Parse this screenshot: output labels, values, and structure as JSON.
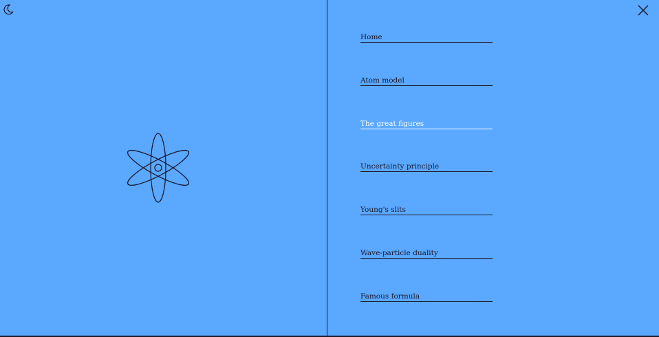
{
  "theme_toggle": {
    "icon": "moon-icon"
  },
  "close": {
    "icon": "close-icon"
  },
  "logo": {
    "icon": "atom-icon"
  },
  "menu": {
    "items": [
      {
        "label": "Home",
        "active": false
      },
      {
        "label": "Atom model",
        "active": false
      },
      {
        "label": "The great figures",
        "active": true
      },
      {
        "label": "Uncertainty principle",
        "active": false
      },
      {
        "label": "Young's slits",
        "active": false
      },
      {
        "label": "Wave-particle duality",
        "active": false
      },
      {
        "label": "Famous formula",
        "active": false
      }
    ]
  },
  "colors": {
    "background": "#5aa8ff",
    "ink": "#1a1a2e",
    "active": "#ffffff"
  }
}
